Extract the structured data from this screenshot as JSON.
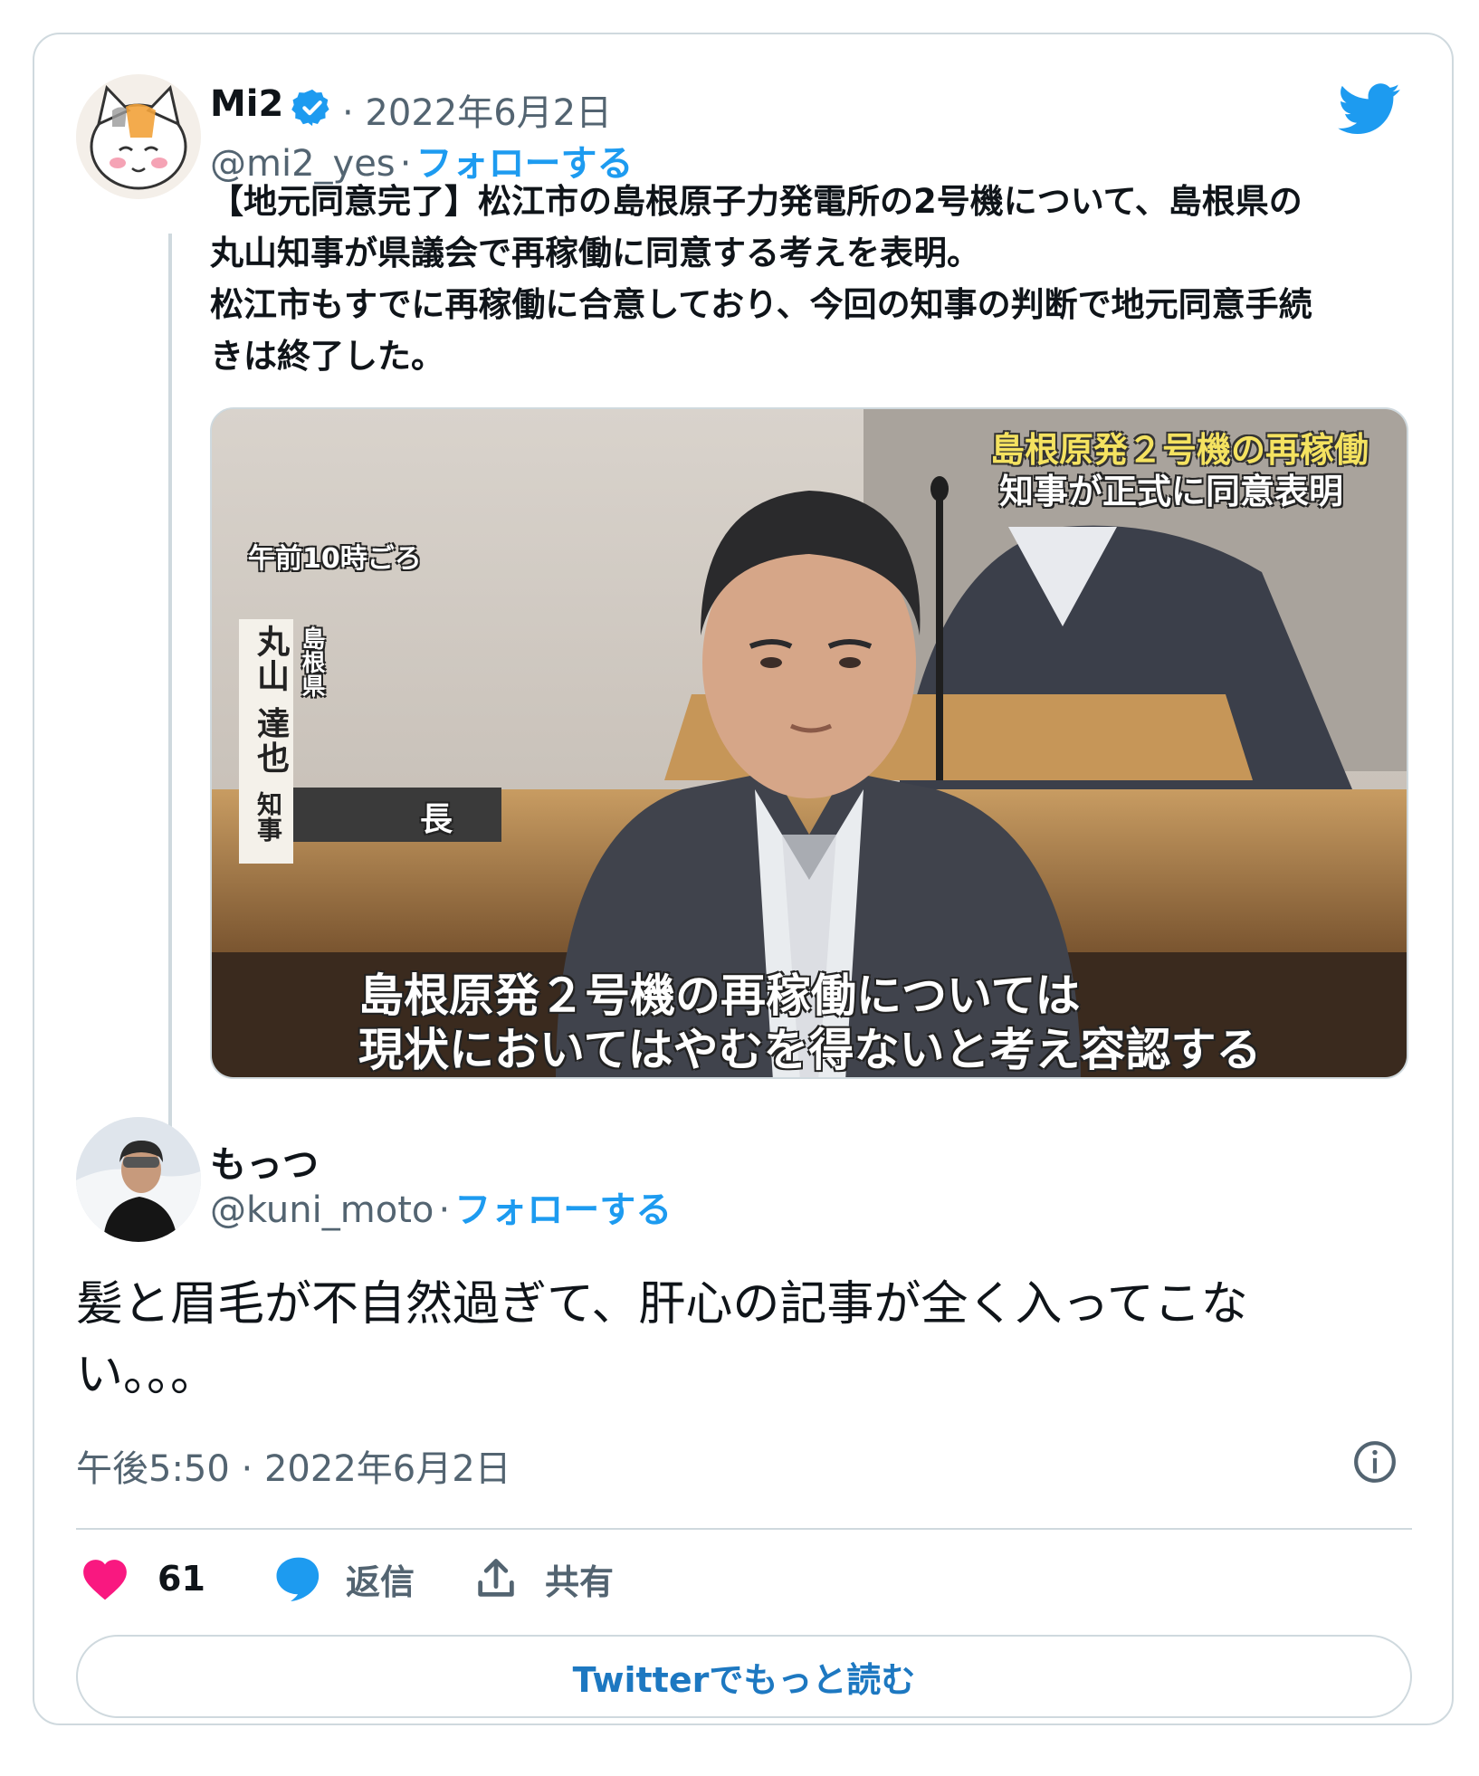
{
  "quoted": {
    "name": "Mi2",
    "date": "· 2022年6月2日",
    "handle": "@mi2_yes",
    "follow_sep": "·",
    "follow_label": "フォローする",
    "text": "【地元同意完了】松江市の島根原子力発電所の2号機について、島根県の\n丸山知事が県議会で再稼働に同意する考えを表明。\n松江市もすでに再稼働に合意しており、今回の知事の判断で地元同意手続\nきは終了した。",
    "image": {
      "overlay_title_1": "島根原発２号機の再稼働",
      "overlay_title_2": "知事が正式に同意表明",
      "time_caption": "午前10時ごろ",
      "name_main": "丸山 達也",
      "name_pref": "島根県",
      "name_role": "知事",
      "plate": "長",
      "subtitle_1": "島根原発２号機の再稼働については",
      "subtitle_2": "現状においてはやむを得ないと考え容認する"
    }
  },
  "reply": {
    "name": "もっつ",
    "handle": "@kuni_moto",
    "follow_sep": "·",
    "follow_label": "フォローする",
    "text": "髪と眉毛が不自然過ぎて、肝心の記事が全く入ってこな\nい。。。",
    "timestamp": "午後5:50 · 2022年6月2日"
  },
  "actions": {
    "likes": "61",
    "reply_label": "返信",
    "share_label": "共有"
  },
  "read_more_label": "Twitterでもっと読む",
  "colors": {
    "accent": "#1d9bf0",
    "like": "#f91880",
    "muted": "#536471",
    "border": "#cfd9de"
  },
  "icons": [
    "verified-badge-icon",
    "twitter-bird-icon",
    "info-icon",
    "heart-icon",
    "reply-bubble-icon",
    "share-icon"
  ]
}
